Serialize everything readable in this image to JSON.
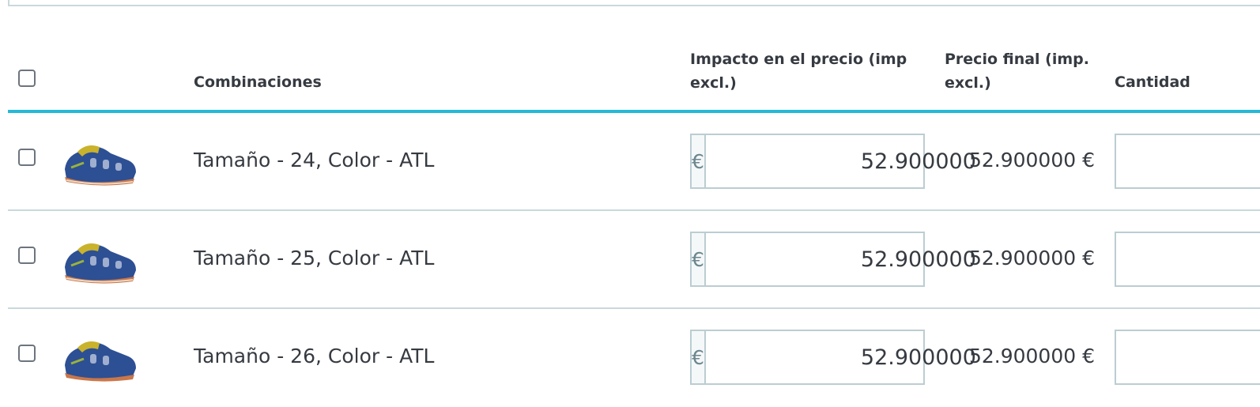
{
  "columns": {
    "select_all": "",
    "combinations": "Combinaciones",
    "price_impact_line1": "Impacto en el precio (imp",
    "price_impact_line2": "excl.)",
    "final_price_line1": "Precio final (imp.",
    "final_price_line2": "excl.)",
    "quantity": "Cantidad"
  },
  "currency_symbol": "€",
  "rows": [
    {
      "name": "Tamaño - 24, Color - ATL",
      "impact": "52.900000",
      "final_price": "52.900000 €",
      "quantity": ""
    },
    {
      "name": "Tamaño - 25, Color - ATL",
      "impact": "52.900000",
      "final_price": "52.900000 €",
      "quantity": ""
    },
    {
      "name": "Tamaño - 26, Color - ATL",
      "impact": "52.900000",
      "final_price": "52.900000 €",
      "quantity": ""
    }
  ],
  "colors": {
    "accent": "#25b9d7",
    "border": "#bbcdd2",
    "text": "#363a41"
  }
}
